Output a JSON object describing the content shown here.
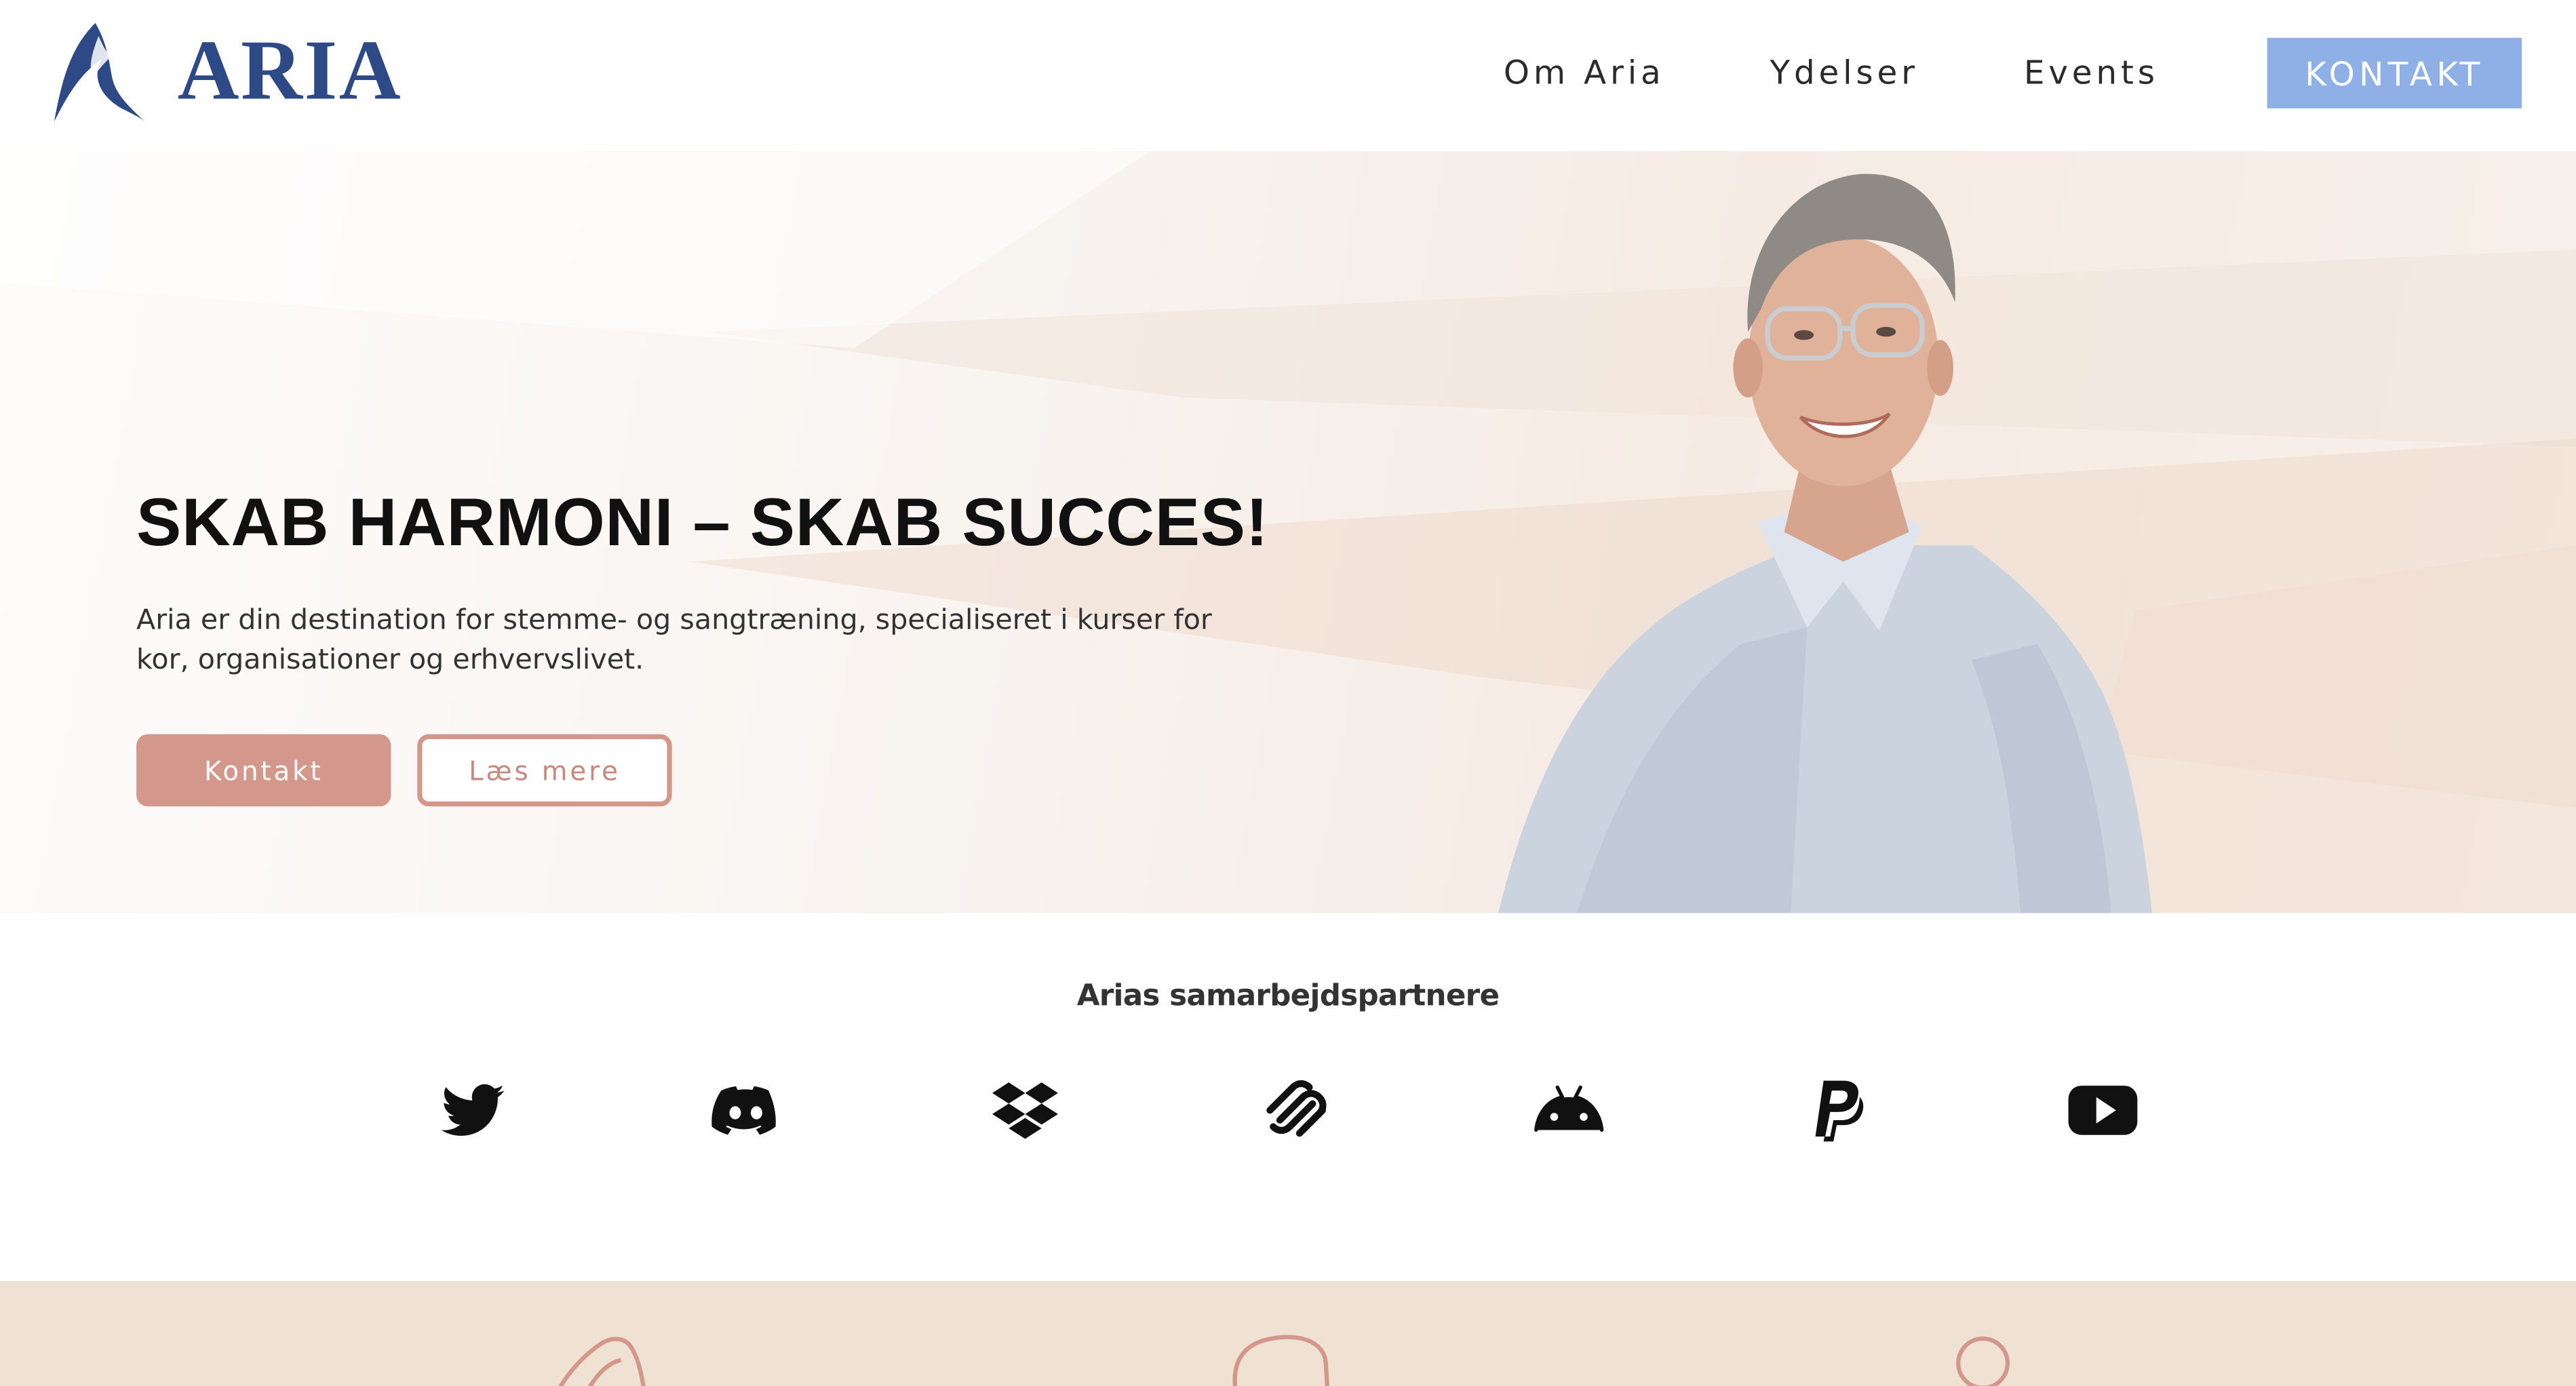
{
  "brand": {
    "name": "ARIA",
    "color": "#2e4a86",
    "logo_icon": "flame-swoosh-icon"
  },
  "nav": {
    "items": [
      {
        "label": "Om Aria"
      },
      {
        "label": "Ydelser"
      },
      {
        "label": "Events"
      }
    ],
    "cta_label": "KONTAKT",
    "cta_color": "#8fb0e6"
  },
  "hero": {
    "title_prefix": "SKAB HARMONI – SKAB ",
    "title_emphasis": "SUCCES!",
    "description": "Aria er din destination for stemme- og sangtræning, specialiseret i kurser for kor, organisationer og erhvervslivet.",
    "primary_button": "Kontakt",
    "secondary_button": "Læs mere",
    "accent_color": "#d4978c",
    "image": "portrait-photo"
  },
  "partners": {
    "title": "Arias samarbejdspartnere",
    "icons": [
      "twitter-icon",
      "discord-icon",
      "dropbox-icon",
      "squarespace-icon",
      "android-icon",
      "paypal-icon",
      "youtube-icon"
    ]
  },
  "features_band": {
    "background": "#efe2d3",
    "icons": [
      "lips-icon",
      "speech-bubble-icon",
      "person-icon"
    ]
  }
}
